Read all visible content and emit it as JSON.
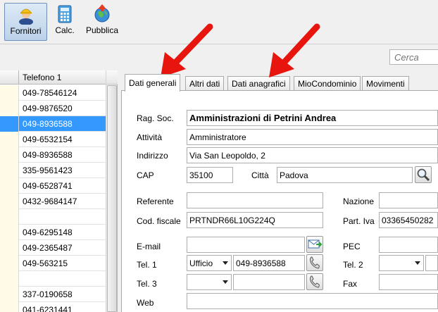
{
  "toolbar": {
    "buttons": [
      {
        "label": "Fornitori",
        "icon": "worker-icon",
        "active": true
      },
      {
        "label": "Calc.",
        "icon": "calculator-icon"
      },
      {
        "label": "Pubblica",
        "icon": "globe-upload-icon"
      }
    ]
  },
  "search": {
    "placeholder": "Cerca"
  },
  "grid": {
    "column_header": "Telefono 1",
    "rows": [
      {
        "phone": "049-78546124"
      },
      {
        "phone": "049-9876520"
      },
      {
        "phone": "049-8936588",
        "selected": true
      },
      {
        "phone": "049-6532154"
      },
      {
        "phone": "049-8936588"
      },
      {
        "phone": "335-9561423"
      },
      {
        "phone": "049-6528741"
      },
      {
        "phone": "0432-9684147"
      },
      {
        "phone": ""
      },
      {
        "phone": "049-6295148"
      },
      {
        "phone": "049-2365487"
      },
      {
        "phone": "049-563215"
      },
      {
        "phone": ""
      },
      {
        "phone": "337-0190658"
      },
      {
        "phone": "041-6231441"
      }
    ]
  },
  "tabs": [
    {
      "label": "Dati generali",
      "active": true
    },
    {
      "label": "Altri dati"
    },
    {
      "label": "Dati anagrafici"
    },
    {
      "label": "MioCondominio"
    },
    {
      "label": "Movimenti"
    }
  ],
  "form": {
    "rag_soc_label": "Rag. Soc.",
    "rag_soc_value": "Amministrazioni di Petrini Andrea",
    "attivita_label": "Attività",
    "attivita_value": "Amministratore",
    "indirizzo_label": "Indirizzo",
    "indirizzo_value": "Via San Leopoldo, 2",
    "cap_label": "CAP",
    "cap_value": "35100",
    "citta_label": "Città",
    "citta_value": "Padova",
    "referente_label": "Referente",
    "referente_value": "",
    "nazione_label": "Nazione",
    "nazione_value": "",
    "cod_fiscale_label": "Cod. fiscale",
    "cod_fiscale_value": "PRTNDR66L10G224Q",
    "part_iva_label": "Part. Iva",
    "part_iva_value": "03365450282",
    "email_label": "E-mail",
    "email_value": "",
    "pec_label": "PEC",
    "pec_value": "",
    "tel1_label": "Tel. 1",
    "tel1_type": "Ufficio",
    "tel1_value": "049-8936588",
    "tel2_label": "Tel. 2",
    "tel2_type": "",
    "tel3_label": "Tel. 3",
    "tel3_type": "",
    "tel3_value": "",
    "fax_label": "Fax",
    "fax_value": "",
    "web_label": "Web",
    "web_value": ""
  },
  "colors": {
    "selection": "#3399ff",
    "arrow": "#e8140e",
    "row_marker": "#fffbe6"
  }
}
